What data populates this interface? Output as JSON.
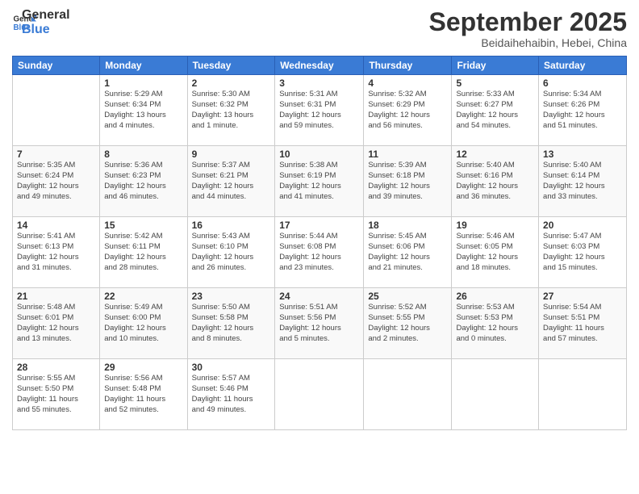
{
  "header": {
    "logo": {
      "line1": "General",
      "line2": "Blue"
    },
    "title": "September 2025",
    "subtitle": "Beidaihehaibin, Hebei, China"
  },
  "days_of_week": [
    "Sunday",
    "Monday",
    "Tuesday",
    "Wednesday",
    "Thursday",
    "Friday",
    "Saturday"
  ],
  "weeks": [
    [
      {
        "day": "",
        "info": ""
      },
      {
        "day": "1",
        "info": "Sunrise: 5:29 AM\nSunset: 6:34 PM\nDaylight: 13 hours\nand 4 minutes."
      },
      {
        "day": "2",
        "info": "Sunrise: 5:30 AM\nSunset: 6:32 PM\nDaylight: 13 hours\nand 1 minute."
      },
      {
        "day": "3",
        "info": "Sunrise: 5:31 AM\nSunset: 6:31 PM\nDaylight: 12 hours\nand 59 minutes."
      },
      {
        "day": "4",
        "info": "Sunrise: 5:32 AM\nSunset: 6:29 PM\nDaylight: 12 hours\nand 56 minutes."
      },
      {
        "day": "5",
        "info": "Sunrise: 5:33 AM\nSunset: 6:27 PM\nDaylight: 12 hours\nand 54 minutes."
      },
      {
        "day": "6",
        "info": "Sunrise: 5:34 AM\nSunset: 6:26 PM\nDaylight: 12 hours\nand 51 minutes."
      }
    ],
    [
      {
        "day": "7",
        "info": "Sunrise: 5:35 AM\nSunset: 6:24 PM\nDaylight: 12 hours\nand 49 minutes."
      },
      {
        "day": "8",
        "info": "Sunrise: 5:36 AM\nSunset: 6:23 PM\nDaylight: 12 hours\nand 46 minutes."
      },
      {
        "day": "9",
        "info": "Sunrise: 5:37 AM\nSunset: 6:21 PM\nDaylight: 12 hours\nand 44 minutes."
      },
      {
        "day": "10",
        "info": "Sunrise: 5:38 AM\nSunset: 6:19 PM\nDaylight: 12 hours\nand 41 minutes."
      },
      {
        "day": "11",
        "info": "Sunrise: 5:39 AM\nSunset: 6:18 PM\nDaylight: 12 hours\nand 39 minutes."
      },
      {
        "day": "12",
        "info": "Sunrise: 5:40 AM\nSunset: 6:16 PM\nDaylight: 12 hours\nand 36 minutes."
      },
      {
        "day": "13",
        "info": "Sunrise: 5:40 AM\nSunset: 6:14 PM\nDaylight: 12 hours\nand 33 minutes."
      }
    ],
    [
      {
        "day": "14",
        "info": "Sunrise: 5:41 AM\nSunset: 6:13 PM\nDaylight: 12 hours\nand 31 minutes."
      },
      {
        "day": "15",
        "info": "Sunrise: 5:42 AM\nSunset: 6:11 PM\nDaylight: 12 hours\nand 28 minutes."
      },
      {
        "day": "16",
        "info": "Sunrise: 5:43 AM\nSunset: 6:10 PM\nDaylight: 12 hours\nand 26 minutes."
      },
      {
        "day": "17",
        "info": "Sunrise: 5:44 AM\nSunset: 6:08 PM\nDaylight: 12 hours\nand 23 minutes."
      },
      {
        "day": "18",
        "info": "Sunrise: 5:45 AM\nSunset: 6:06 PM\nDaylight: 12 hours\nand 21 minutes."
      },
      {
        "day": "19",
        "info": "Sunrise: 5:46 AM\nSunset: 6:05 PM\nDaylight: 12 hours\nand 18 minutes."
      },
      {
        "day": "20",
        "info": "Sunrise: 5:47 AM\nSunset: 6:03 PM\nDaylight: 12 hours\nand 15 minutes."
      }
    ],
    [
      {
        "day": "21",
        "info": "Sunrise: 5:48 AM\nSunset: 6:01 PM\nDaylight: 12 hours\nand 13 minutes."
      },
      {
        "day": "22",
        "info": "Sunrise: 5:49 AM\nSunset: 6:00 PM\nDaylight: 12 hours\nand 10 minutes."
      },
      {
        "day": "23",
        "info": "Sunrise: 5:50 AM\nSunset: 5:58 PM\nDaylight: 12 hours\nand 8 minutes."
      },
      {
        "day": "24",
        "info": "Sunrise: 5:51 AM\nSunset: 5:56 PM\nDaylight: 12 hours\nand 5 minutes."
      },
      {
        "day": "25",
        "info": "Sunrise: 5:52 AM\nSunset: 5:55 PM\nDaylight: 12 hours\nand 2 minutes."
      },
      {
        "day": "26",
        "info": "Sunrise: 5:53 AM\nSunset: 5:53 PM\nDaylight: 12 hours\nand 0 minutes."
      },
      {
        "day": "27",
        "info": "Sunrise: 5:54 AM\nSunset: 5:51 PM\nDaylight: 11 hours\nand 57 minutes."
      }
    ],
    [
      {
        "day": "28",
        "info": "Sunrise: 5:55 AM\nSunset: 5:50 PM\nDaylight: 11 hours\nand 55 minutes."
      },
      {
        "day": "29",
        "info": "Sunrise: 5:56 AM\nSunset: 5:48 PM\nDaylight: 11 hours\nand 52 minutes."
      },
      {
        "day": "30",
        "info": "Sunrise: 5:57 AM\nSunset: 5:46 PM\nDaylight: 11 hours\nand 49 minutes."
      },
      {
        "day": "",
        "info": ""
      },
      {
        "day": "",
        "info": ""
      },
      {
        "day": "",
        "info": ""
      },
      {
        "day": "",
        "info": ""
      }
    ]
  ]
}
